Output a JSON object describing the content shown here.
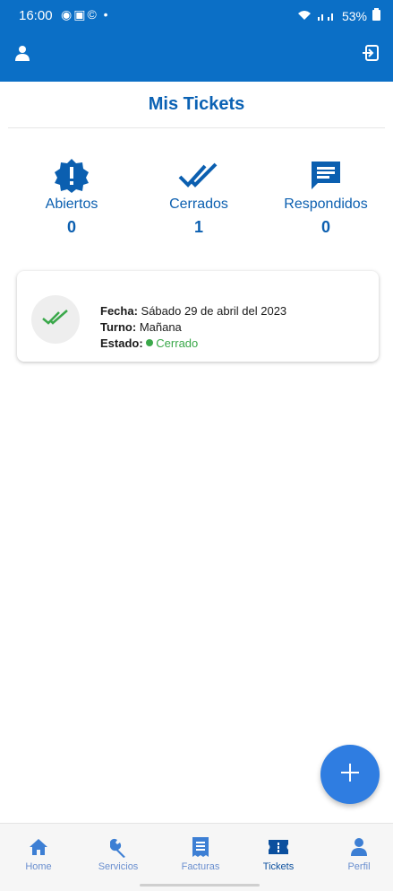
{
  "status_bar": {
    "time": "16:00",
    "left_icons": "◉▣© •",
    "battery": "53%"
  },
  "page": {
    "title": "Mis Tickets"
  },
  "stats": [
    {
      "label": "Abiertos",
      "value": "0"
    },
    {
      "label": "Cerrados",
      "value": "1"
    },
    {
      "label": "Respondidos",
      "value": "0"
    }
  ],
  "ticket": {
    "fecha_label": "Fecha:",
    "fecha_value": "Sábado 29 de abril del 2023",
    "turno_label": "Turno:",
    "turno_value": "Mañana",
    "estado_label": "Estado:",
    "estado_value": "Cerrado"
  },
  "fab": {
    "icon": "plus-icon"
  },
  "bottom_nav": [
    {
      "label": "Home",
      "icon": "home-icon"
    },
    {
      "label": "Servicios",
      "icon": "wrench-icon"
    },
    {
      "label": "Facturas",
      "icon": "receipt-icon"
    },
    {
      "label": "Tickets",
      "icon": "ticket-icon",
      "active": true
    },
    {
      "label": "Perfil",
      "icon": "person-icon"
    }
  ],
  "colors": {
    "primary": "#0b6fc6",
    "accent_dark": "#0b4f9e",
    "fab": "#2f7de1",
    "closed_green": "#3aa84a"
  }
}
